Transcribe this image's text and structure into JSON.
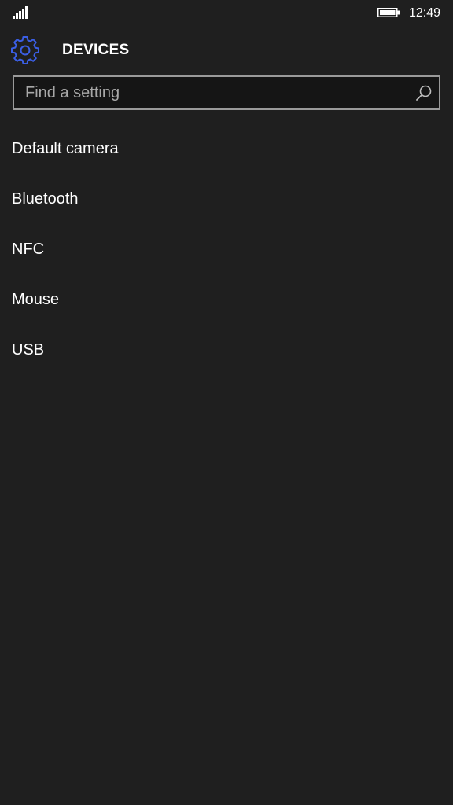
{
  "status_bar": {
    "time": "12:49",
    "signal_icon": "signal-icon",
    "battery_icon": "battery-icon"
  },
  "header": {
    "title": "DEVICES",
    "icon": "gear-icon",
    "icon_color": "#3b5fe6"
  },
  "search": {
    "placeholder": "Find a setting",
    "value": "",
    "icon": "search-icon"
  },
  "settings": {
    "items": [
      {
        "label": "Default camera"
      },
      {
        "label": "Bluetooth"
      },
      {
        "label": "NFC"
      },
      {
        "label": "Mouse"
      },
      {
        "label": "USB"
      }
    ]
  },
  "colors": {
    "background": "#1f1f1f",
    "text": "#ffffff",
    "accent": "#3b5fe6",
    "search_border": "#9a9a9a"
  }
}
